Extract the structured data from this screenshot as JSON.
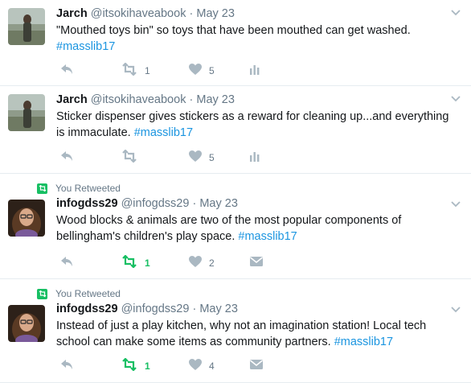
{
  "tweets": [
    {
      "retweeted_label": "",
      "fullname": "Jarch",
      "handle": "@itsokihaveabook",
      "separator": "·",
      "time": "May 23",
      "text_before": "\"Mouthed toys bin\" so toys that have been mouthed can get washed.",
      "hashtag": "#masslib17",
      "reply_count": "",
      "retweet_count": "1",
      "like_count": "5",
      "last_action_icon": "analytics-icon"
    },
    {
      "retweeted_label": "",
      "fullname": "Jarch",
      "handle": "@itsokihaveabook",
      "separator": "·",
      "time": "May 23",
      "text_before": "Sticker dispenser gives stickers as a reward for cleaning up...and everything is immaculate.",
      "hashtag": "#masslib17",
      "reply_count": "",
      "retweet_count": "",
      "like_count": "5",
      "last_action_icon": "analytics-icon"
    },
    {
      "retweeted_label": "You Retweeted",
      "fullname": "infogdss29",
      "handle": "@infogdss29",
      "separator": "·",
      "time": "May 23",
      "text_before": "Wood blocks & animals are two of the most popular components of bellingham's children's play space.",
      "hashtag": "#masslib17",
      "reply_count": "",
      "retweet_count": "1",
      "like_count": "2",
      "last_action_icon": "direct-message-icon"
    },
    {
      "retweeted_label": "You Retweeted",
      "fullname": "infogdss29",
      "handle": "@infogdss29",
      "separator": "·",
      "time": "May 23",
      "text_before": "Instead of just a play kitchen, why not an imagination station! Local tech school can make some items as community partners.",
      "hashtag": "#masslib17",
      "reply_count": "",
      "retweet_count": "1",
      "like_count": "4",
      "last_action_icon": "direct-message-icon"
    }
  ],
  "colors": {
    "text": "#14171a",
    "muted": "#657786",
    "icon": "#aab8c2",
    "link": "#1b95e0",
    "retweet_active": "#17bf63",
    "divider": "#e6ecf0"
  }
}
